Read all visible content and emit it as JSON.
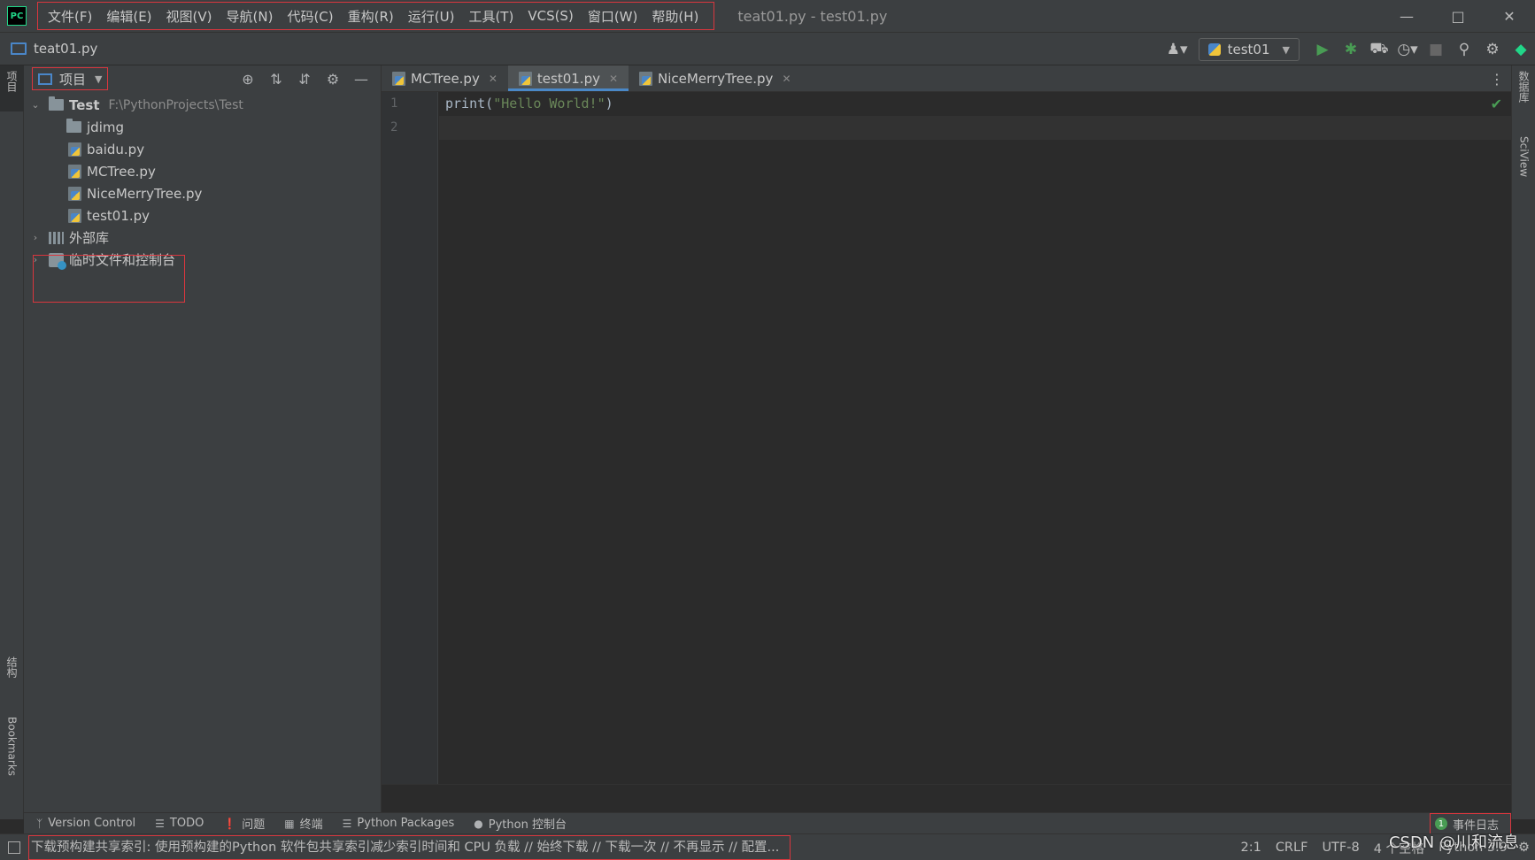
{
  "app": {
    "logo_text": "PC",
    "window_title": "teat01.py - test01.py"
  },
  "menu": [
    "文件(F)",
    "编辑(E)",
    "视图(V)",
    "导航(N)",
    "代码(C)",
    "重构(R)",
    "运行(U)",
    "工具(T)",
    "VCS(S)",
    "窗口(W)",
    "帮助(H)"
  ],
  "navbar": {
    "file": "teat01.py",
    "run_config": "test01"
  },
  "left_strip": {
    "project_tab": "项目",
    "structure_tab": "结构",
    "bookmarks_tab": "Bookmarks"
  },
  "right_strip": {
    "database_tab": "数据库",
    "sciview_tab": "SciView"
  },
  "project_panel": {
    "title": "项目",
    "root": {
      "name": "Test",
      "path": "F:\\PythonProjects\\Test"
    },
    "items": [
      {
        "name": "jdimg",
        "type": "folder"
      },
      {
        "name": "baidu.py",
        "type": "py"
      },
      {
        "name": "MCTree.py",
        "type": "py"
      },
      {
        "name": "NiceMerryTree.py",
        "type": "py"
      },
      {
        "name": "test01.py",
        "type": "py"
      }
    ],
    "external_libs": "外部库",
    "scratches": "临时文件和控制台"
  },
  "editor": {
    "tabs": [
      {
        "label": "MCTree.py",
        "active": false
      },
      {
        "label": "test01.py",
        "active": true
      },
      {
        "label": "NiceMerryTree.py",
        "active": false
      }
    ],
    "lines": [
      "1",
      "2"
    ],
    "code": {
      "fn": "print(",
      "str": "\"Hello World!\"",
      "close": ")"
    }
  },
  "tool_windows": [
    "Version Control",
    "TODO",
    "问题",
    "终端",
    "Python Packages",
    "Python 控制台"
  ],
  "event_log": {
    "count": "1",
    "label": "事件日志"
  },
  "status": {
    "message": "下载预构建共享索引: 使用预构建的Python 软件包共享索引减少索引时间和 CPU 负载 // 始终下载 // 下载一次 // 不再显示 // 配置...",
    "position": "2:1",
    "line_sep": "CRLF",
    "encoding": "UTF-8",
    "indent": "4 个空格",
    "interpreter": "Python 3.9"
  },
  "watermark": "CSDN @川和流息",
  "colors": {
    "accent": "#4a88c7",
    "highlight": "#d9363e",
    "success": "#499c54"
  }
}
